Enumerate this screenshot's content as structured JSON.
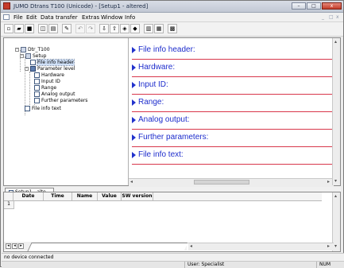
{
  "window": {
    "title": "JUMO Dtrans T100 (Unicode) - [Setup1 - altered]",
    "controls": [
      "minimize-button",
      "maximize-button",
      "close-button"
    ]
  },
  "menu": {
    "items": [
      "File",
      "Edit",
      "Data transfer",
      "Extras",
      "Window",
      "Info"
    ],
    "mdi_controls": [
      "_",
      "□",
      "x"
    ]
  },
  "toolbar": {
    "icons": [
      "new-icon",
      "open-icon",
      "save-icon",
      "print-preview-icon",
      "print-icon",
      "edit-icon",
      "undo-icon",
      "redo-icon",
      "read-device-icon",
      "write-device-icon",
      "connect-icon",
      "assistant-icon",
      "tile-icon",
      "window-icon"
    ]
  },
  "tree": {
    "root": "Dtr_T100",
    "setup": "Setup",
    "file_info_header": "File info header",
    "parameter_level": "Parameter level",
    "hardware": "Hardware",
    "input_id": "Input ID",
    "range": "Range",
    "analog_output": "Analog output",
    "further_parameters": "Further parameters",
    "file_info_text": "File info text"
  },
  "sections": [
    "File info header:",
    "Hardware:",
    "Input ID:",
    "Range:",
    "Analog output:",
    "Further parameters:",
    "File info text:"
  ],
  "doc_tab": "Setup1 - alte...",
  "grid": {
    "columns": [
      "Date",
      "Time",
      "Name",
      "Value",
      "SW version"
    ],
    "row_number": "1"
  },
  "status": {
    "connection": "no device connected",
    "user": "User: Specialist",
    "num": "NUM"
  },
  "colors": {
    "section_text": "#1d2ccc",
    "section_rule": "#d8384c"
  }
}
